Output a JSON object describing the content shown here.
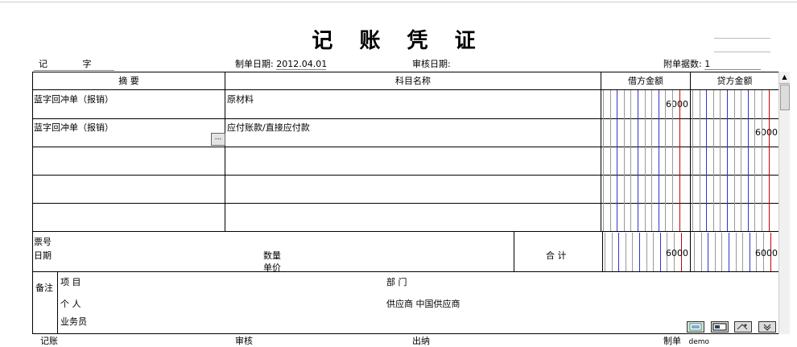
{
  "title": "记 账 凭 证",
  "header": {
    "voucher_word": "记",
    "voucher_char": "字",
    "make_date_label": "制单日期:",
    "make_date": "2012.04.01",
    "audit_date_label": "审核日期:",
    "attach_label": "附单据数:",
    "attach_count": "1"
  },
  "columns": {
    "summary": "摘 要",
    "account": "科目名称",
    "debit": "借方金额",
    "credit": "贷方金额"
  },
  "rows": [
    {
      "summary": "蓝字回冲单（报销）",
      "account": "原材料",
      "debit": "6000",
      "credit": ""
    },
    {
      "summary": "蓝字回冲单（报销）",
      "account": "应付账款/直接应付款",
      "debit": "",
      "credit": "6000"
    },
    {
      "summary": "",
      "account": "",
      "debit": "",
      "credit": ""
    },
    {
      "summary": "",
      "account": "",
      "debit": "",
      "credit": ""
    },
    {
      "summary": "",
      "account": "",
      "debit": "",
      "credit": ""
    }
  ],
  "footer_info": {
    "ticket_no_label": "票号",
    "date_label": "日期",
    "quantity_label": "数量",
    "unit_label": "单价",
    "total_label": "合 计",
    "total_debit": "6000",
    "total_credit": "6000"
  },
  "remarks": {
    "label": "备注",
    "project_label": "项 目",
    "dept_label": "部 门",
    "person_label": "个 人",
    "supplier_label": "供应商",
    "supplier_value": "中国供应商",
    "salesman_label": "业务员"
  },
  "signatures": {
    "bookkeeper": "记账",
    "auditor": "审核",
    "cashier": "出纳",
    "maker": "制单",
    "maker_name": "demo"
  },
  "ellipsis_button": "...",
  "colors": {
    "blue_line": "#3333cc",
    "red_line": "#cc0000",
    "gray_line": "#999999"
  }
}
